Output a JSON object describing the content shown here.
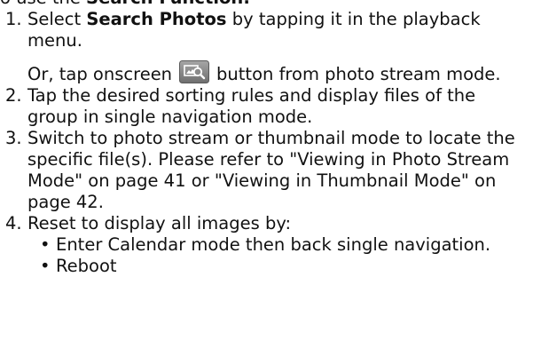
{
  "intro": {
    "prefix": "o use the ",
    "bold": "Search Function:",
    "suffix": ""
  },
  "steps": [
    {
      "number": "1.",
      "text_before": "Select ",
      "bold": "Search Photos",
      "text_after": " by tapping it in the playback menu.",
      "sub_before": "Or, tap onscreen",
      "sub_icon": "search-photos-icon",
      "sub_after": "button from photo stream mode."
    },
    {
      "number": "2.",
      "text": "Tap the desired sorting rules and display files of the group in single navigation mode."
    },
    {
      "number": "3.",
      "text": "Switch to photo stream or thumbnail mode to locate the specific file(s). Please refer to \"Viewing in Photo Stream Mode\" on page 41 or \"Viewing in Thumbnail Mode\" on page 42."
    },
    {
      "number": "4.",
      "text": "Reset to display all images by:",
      "bullets": [
        "Enter Calendar mode then back single navigation.",
        "Reboot"
      ]
    }
  ],
  "colors": {
    "text": "#111111",
    "icon_bg": "#8a8a8a",
    "icon_fg": "#ffffff"
  }
}
